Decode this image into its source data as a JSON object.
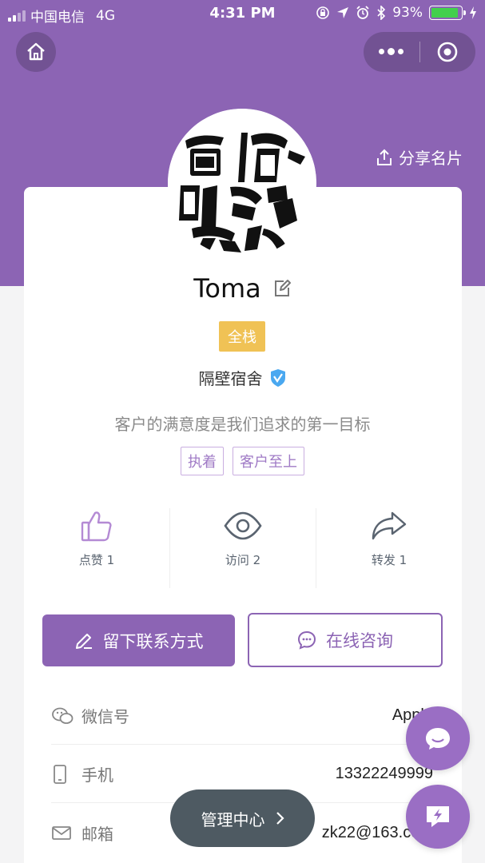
{
  "status_bar": {
    "carrier": "中国电信",
    "network": "4G",
    "time": "4:31 PM",
    "battery": "93%"
  },
  "header": {
    "share_label": "分享名片"
  },
  "profile": {
    "avatar_icon": "calligraphy-avatar",
    "name": "Toma",
    "role_tag": "全栈",
    "company": "隔壁宿舍",
    "motto": "客户的满意度是我们追求的第一目标",
    "tags": [
      "执着",
      "客户至上"
    ]
  },
  "stats": [
    {
      "label": "点赞 1",
      "icon": "thumbs-up-icon"
    },
    {
      "label": "访问 2",
      "icon": "eye-icon"
    },
    {
      "label": "转发 1",
      "icon": "forward-icon"
    }
  ],
  "actions": {
    "leave_contact": "留下联系方式",
    "consult_online": "在线咨询"
  },
  "contact": {
    "wechat_label": "微信号",
    "wechat_value": "Apple",
    "phone_label": "手机",
    "phone_value": "13322249999",
    "email_label": "邮箱",
    "email_value": "zk22@163.com"
  },
  "manage_center": "管理中心",
  "colors": {
    "brand": "#8c64b4",
    "tag_yellow": "#f0c255",
    "verified": "#4aa8f0"
  }
}
